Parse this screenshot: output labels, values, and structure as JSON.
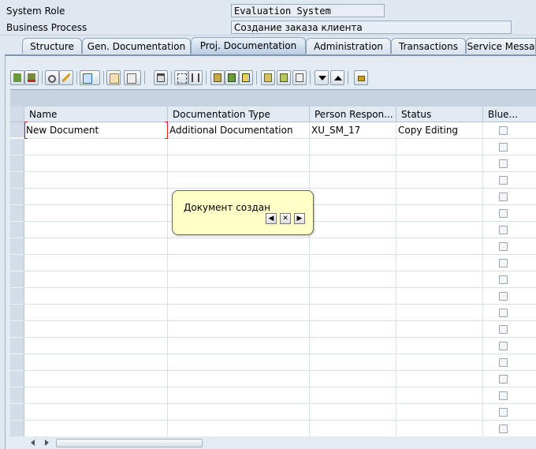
{
  "fields": {
    "system_role": {
      "label": "System Role",
      "value": "Evaluation System"
    },
    "business_process": {
      "label": "Business Process",
      "value": "Создание заказа клиента"
    }
  },
  "tabs": [
    {
      "label": "Structure"
    },
    {
      "label": "Gen. Documentation"
    },
    {
      "label": "Proj. Documentation",
      "active": true
    },
    {
      "label": "Administration"
    },
    {
      "label": "Transactions"
    },
    {
      "label": "Service Messa"
    }
  ],
  "toolbar_icons": [
    "insert-row-icon",
    "delete-row-icon",
    "glasses-icon",
    "pencil-icon",
    "copy-icon",
    "paste-icon",
    "clipboard-icon",
    "trash-icon",
    "move-icon",
    "expand-icon",
    "document-icon",
    "import-icon",
    "export-icon",
    "list-icon",
    "report-icon",
    "print-icon",
    "arrow-down-icon",
    "arrow-up-icon",
    "lock-icon"
  ],
  "table": {
    "columns": [
      "Name",
      "Documentation Type",
      "Person Respon...",
      "Status",
      "Blue..."
    ],
    "rows": [
      {
        "name": "New Document",
        "doc_type": "Additional Documentation",
        "person": "XU_SM_17",
        "status": "Copy Editing"
      }
    ]
  },
  "popup": {
    "message": "Документ создан"
  },
  "colors": {
    "accent": "#7c94ac",
    "popup_bg": "#ffffc8",
    "selection": "#d62020"
  }
}
